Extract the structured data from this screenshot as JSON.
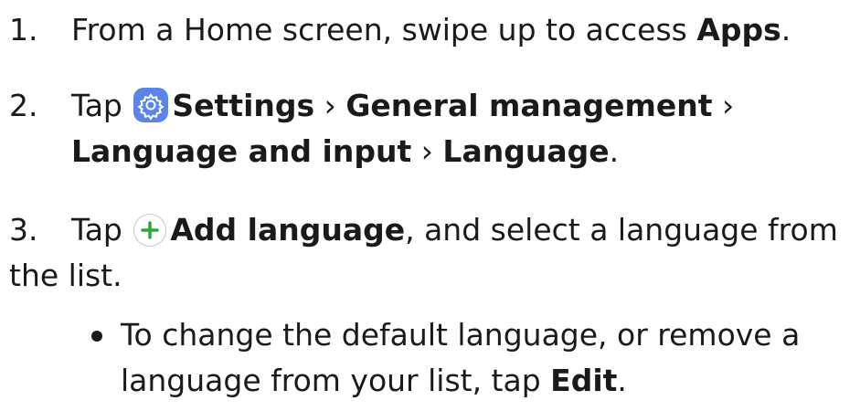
{
  "steps": [
    {
      "number": "1.",
      "text_before": "From a Home screen, swipe up to access ",
      "bold": "Apps",
      "text_after": "."
    },
    {
      "number": "2.",
      "tap": "Tap",
      "icon": "settings-gear-icon",
      "settings": "Settings",
      "sep1": " › ",
      "general": "General management",
      "sep2": " ›",
      "language_input": "Language and input",
      "sep3": " › ",
      "language": "Language",
      "end": "."
    },
    {
      "number": "3.",
      "tap": "Tap",
      "icon": "add-plus-icon",
      "add_language": "Add language",
      "text_after": ", and select a language from",
      "line2": "the list."
    }
  ],
  "bullet": {
    "line1": "To change the default language, or remove a",
    "line2_before": "language from your list, tap ",
    "edit": "Edit",
    "line2_after": "."
  },
  "colors": {
    "settings_icon_bg": "#5b86e8",
    "plus_icon": "#2fa836"
  }
}
